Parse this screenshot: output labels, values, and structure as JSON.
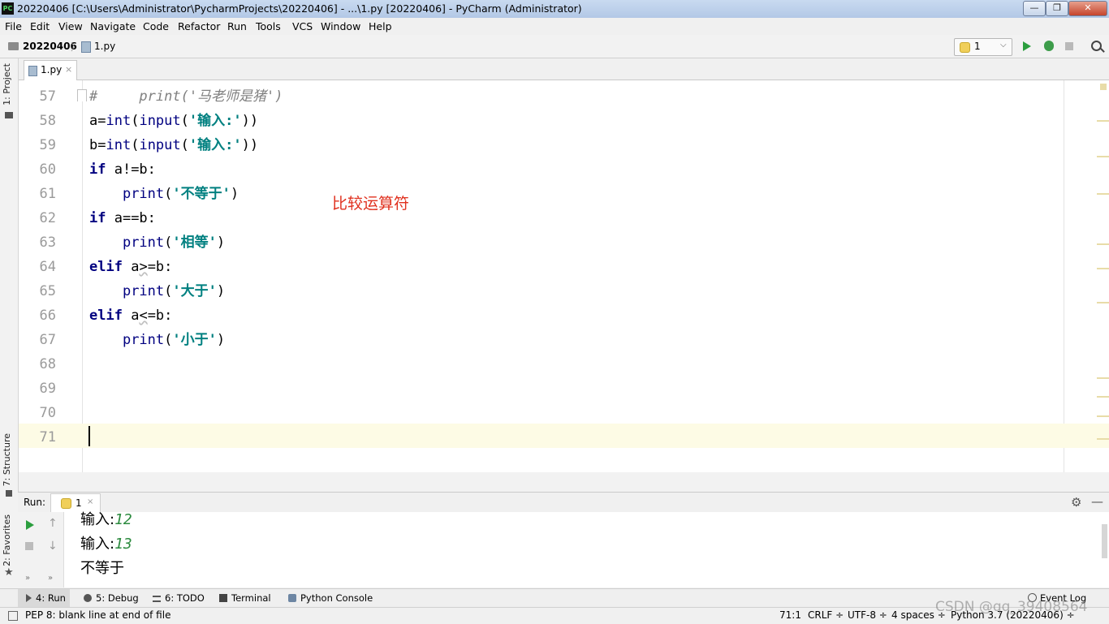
{
  "window": {
    "title": "20220406 [C:\\Users\\Administrator\\PycharmProjects\\20220406] - ...\\1.py [20220406] - PyCharm (Administrator)",
    "app_icon_text": "PC",
    "minimize": "—",
    "maximize": "❐",
    "close": "✕"
  },
  "menu": [
    "File",
    "Edit",
    "View",
    "Navigate",
    "Code",
    "Refactor",
    "Run",
    "Tools",
    "VCS",
    "Window",
    "Help"
  ],
  "navbar": {
    "project": "20220406",
    "separator": "〉",
    "file": "1.py",
    "run_config": "1",
    "run_config_arrow": "⌵"
  },
  "left_tabs": {
    "project": "1: Project",
    "structure": "7: Structure",
    "favorites": "2: Favorites"
  },
  "editor": {
    "tab_label": "1.py",
    "tab_close": "×",
    "lines": [
      {
        "no": "57",
        "parts": [
          {
            "t": "#     print('马老师是猪')",
            "c": "cmt"
          }
        ]
      },
      {
        "no": "58",
        "parts": [
          {
            "t": "a=",
            "c": ""
          },
          {
            "t": "int",
            "c": "bi"
          },
          {
            "t": "(",
            "c": ""
          },
          {
            "t": "input",
            "c": "bi"
          },
          {
            "t": "(",
            "c": ""
          },
          {
            "t": "'输入:'",
            "c": "str"
          },
          {
            "t": "))",
            "c": ""
          }
        ]
      },
      {
        "no": "59",
        "parts": [
          {
            "t": "b=",
            "c": ""
          },
          {
            "t": "int",
            "c": "bi"
          },
          {
            "t": "(",
            "c": ""
          },
          {
            "t": "input",
            "c": "bi"
          },
          {
            "t": "(",
            "c": ""
          },
          {
            "t": "'输入:'",
            "c": "str"
          },
          {
            "t": "))",
            "c": ""
          }
        ]
      },
      {
        "no": "60",
        "parts": [
          {
            "t": "if",
            "c": "kw"
          },
          {
            "t": " a!=b:",
            "c": ""
          }
        ]
      },
      {
        "no": "61",
        "parts": [
          {
            "t": "    ",
            "c": ""
          },
          {
            "t": "print",
            "c": "bi"
          },
          {
            "t": "(",
            "c": ""
          },
          {
            "t": "'不等于'",
            "c": "str"
          },
          {
            "t": ")",
            "c": ""
          }
        ]
      },
      {
        "no": "62",
        "parts": [
          {
            "t": "if",
            "c": "kw"
          },
          {
            "t": " a==b:",
            "c": ""
          }
        ]
      },
      {
        "no": "63",
        "parts": [
          {
            "t": "    ",
            "c": ""
          },
          {
            "t": "print",
            "c": "bi"
          },
          {
            "t": "(",
            "c": ""
          },
          {
            "t": "'相等'",
            "c": "str"
          },
          {
            "t": ")",
            "c": ""
          }
        ]
      },
      {
        "no": "64",
        "parts": [
          {
            "t": "elif",
            "c": "kw"
          },
          {
            "t": " a",
            "c": ""
          },
          {
            "t": ">",
            "c": "squiggle"
          },
          {
            "t": "=b:",
            "c": ""
          }
        ]
      },
      {
        "no": "65",
        "parts": [
          {
            "t": "    ",
            "c": ""
          },
          {
            "t": "print",
            "c": "bi"
          },
          {
            "t": "(",
            "c": ""
          },
          {
            "t": "'大于'",
            "c": "str"
          },
          {
            "t": ")",
            "c": ""
          }
        ]
      },
      {
        "no": "66",
        "parts": [
          {
            "t": "elif",
            "c": "kw"
          },
          {
            "t": " a",
            "c": ""
          },
          {
            "t": "<",
            "c": "squiggle"
          },
          {
            "t": "=b:",
            "c": ""
          }
        ]
      },
      {
        "no": "67",
        "parts": [
          {
            "t": "    ",
            "c": ""
          },
          {
            "t": "print",
            "c": "bi"
          },
          {
            "t": "(",
            "c": ""
          },
          {
            "t": "'小于'",
            "c": "str"
          },
          {
            "t": ")",
            "c": ""
          }
        ]
      },
      {
        "no": "68",
        "parts": []
      },
      {
        "no": "69",
        "parts": []
      },
      {
        "no": "70",
        "parts": []
      },
      {
        "no": "71",
        "parts": []
      }
    ],
    "annotation": "比较运算符"
  },
  "run_panel": {
    "label": "Run:",
    "tab_label": "1",
    "tab_close": "×",
    "gear": "⚙",
    "minimize": "—",
    "up": "↑",
    "down": "↓",
    "more": "»",
    "console": [
      {
        "prompt": "输入:",
        "input": "12"
      },
      {
        "prompt": "输入:",
        "input": "13"
      },
      {
        "prompt": "不等于",
        "input": ""
      }
    ]
  },
  "tool_tabs": {
    "run": "4: Run",
    "debug": "5: Debug",
    "todo": "6: TODO",
    "terminal": "Terminal",
    "python_console": "Python Console",
    "event_log": "Event Log"
  },
  "status": {
    "message": "PEP 8: blank line at end of file",
    "position": "71:1",
    "line_sep": "CRLF ÷",
    "encoding": "UTF-8 ÷",
    "indent": "4 spaces ÷",
    "interpreter": "Python 3.7 (20220406) ÷"
  },
  "watermark": "CSDN @qq_39408564",
  "colors": {
    "keyword": "#000080",
    "string": "#008080",
    "comment": "#808080",
    "annotation": "#e0301e",
    "user_input": "#2b8a3e",
    "current_line": "#fdfbe5"
  }
}
